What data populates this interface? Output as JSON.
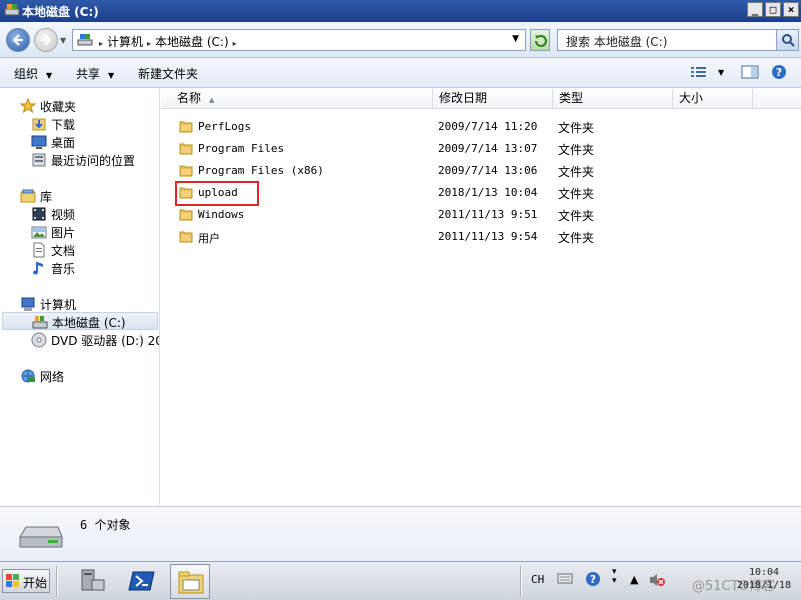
{
  "window": {
    "title": "本地磁盘 (C:)"
  },
  "address": {
    "crumbs": [
      "计算机",
      "本地磁盘 (C:)"
    ],
    "search_placeholder": "搜索 本地磁盘 (C:)"
  },
  "toolbar": {
    "organize": "组织",
    "share": "共享",
    "new_folder": "新建文件夹"
  },
  "sidebar": {
    "favorites": "收藏夹",
    "downloads": "下载",
    "desktop": "桌面",
    "recent": "最近访问的位置",
    "libraries": "库",
    "videos": "视频",
    "pictures": "图片",
    "documents": "文档",
    "music": "音乐",
    "computer": "计算机",
    "local_disk": "本地磁盘 (C:)",
    "dvd": "DVD 驱动器 (D:) 20",
    "network": "网络"
  },
  "columns": {
    "name": "名称",
    "date": "修改日期",
    "type": "类型",
    "size": "大小"
  },
  "files": [
    {
      "name": "PerfLogs",
      "date": "2009/7/14 11:20",
      "type": "文件夹"
    },
    {
      "name": "Program Files",
      "date": "2009/7/14 13:07",
      "type": "文件夹"
    },
    {
      "name": "Program Files (x86)",
      "date": "2009/7/14 13:06",
      "type": "文件夹"
    },
    {
      "name": "upload",
      "date": "2018/1/13 10:04",
      "type": "文件夹"
    },
    {
      "name": "Windows",
      "date": "2011/11/13 9:51",
      "type": "文件夹"
    },
    {
      "name": "用户",
      "date": "2011/11/13 9:54",
      "type": "文件夹"
    }
  ],
  "details": {
    "count": "6 个对象"
  },
  "taskbar": {
    "start": "开始",
    "lang": "CH",
    "time": "10:04",
    "date": "2018/1/18"
  },
  "watermark": "@51CTO博客",
  "colors": {
    "title_bar": "#1c3f8c",
    "highlight_box": "#e0242a",
    "folder": "#e8c15a"
  }
}
